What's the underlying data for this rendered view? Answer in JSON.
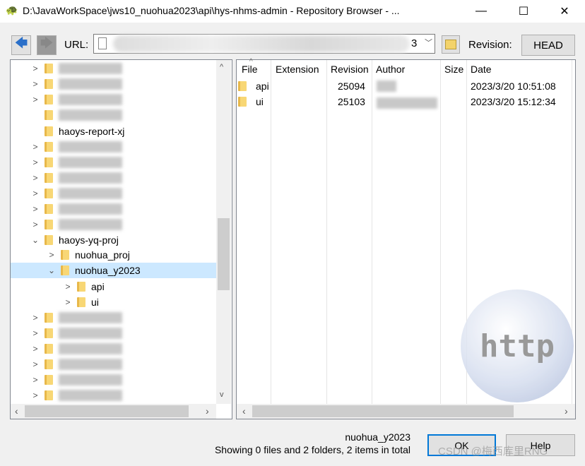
{
  "window": {
    "title": "D:\\JavaWorkSpace\\jws10_nuohua2023\\api\\hys-nhms-admin - Repository Browser - ...",
    "minimize": "—",
    "maximize": "☐",
    "close": "✕"
  },
  "toolbar": {
    "back": "🡄",
    "forward": "🡆",
    "url_label": "URL:",
    "url_visible_tail": "3",
    "revision_label": "Revision:",
    "revision_button": "HEAD"
  },
  "tree": {
    "items": [
      {
        "label": "",
        "level": 1,
        "expander": ">"
      },
      {
        "label": "",
        "level": 1,
        "expander": ">"
      },
      {
        "label": "",
        "level": 1,
        "expander": ">"
      },
      {
        "label": "",
        "level": 1,
        "expander": ""
      },
      {
        "label": "haoys-report-xj",
        "level": 1,
        "expander": ""
      },
      {
        "label": "",
        "level": 1,
        "expander": ">"
      },
      {
        "label": "",
        "level": 1,
        "expander": ">"
      },
      {
        "label": "",
        "level": 1,
        "expander": ">"
      },
      {
        "label": "",
        "level": 1,
        "expander": ">"
      },
      {
        "label": "",
        "level": 1,
        "expander": ">"
      },
      {
        "label": "",
        "level": 1,
        "expander": ">"
      },
      {
        "label": "haoys-yq-proj",
        "level": 1,
        "expander": "⌄"
      },
      {
        "label": "nuohua_proj",
        "level": 2,
        "expander": ">"
      },
      {
        "label": "nuohua_y2023",
        "level": 2,
        "expander": "⌄",
        "selected": true
      },
      {
        "label": "api",
        "level": 3,
        "expander": ">"
      },
      {
        "label": "ui",
        "level": 3,
        "expander": ">"
      },
      {
        "label": "",
        "level": 1,
        "expander": ">"
      },
      {
        "label": "",
        "level": 1,
        "expander": ">"
      },
      {
        "label": "",
        "level": 1,
        "expander": ">"
      },
      {
        "label": "",
        "level": 1,
        "expander": ">"
      },
      {
        "label": "",
        "level": 1,
        "expander": ">"
      },
      {
        "label": "",
        "level": 1,
        "expander": ">"
      }
    ]
  },
  "list": {
    "columns": [
      "File",
      "Extension",
      "Revision",
      "Author",
      "Size",
      "Date"
    ],
    "rows": [
      {
        "file": "api",
        "revision": "25094",
        "date": "2023/3/20 10:51:08"
      },
      {
        "file": "ui",
        "revision": "25103",
        "date": "2023/3/20 15:12:34"
      }
    ]
  },
  "status": {
    "selected": "nuohua_y2023",
    "summary": "Showing 0 files and 2 folders, 2 items in total"
  },
  "buttons": {
    "ok": "OK",
    "help": "Help"
  },
  "watermark": "CSDN @梅西库里RNG",
  "globe_text": "http"
}
